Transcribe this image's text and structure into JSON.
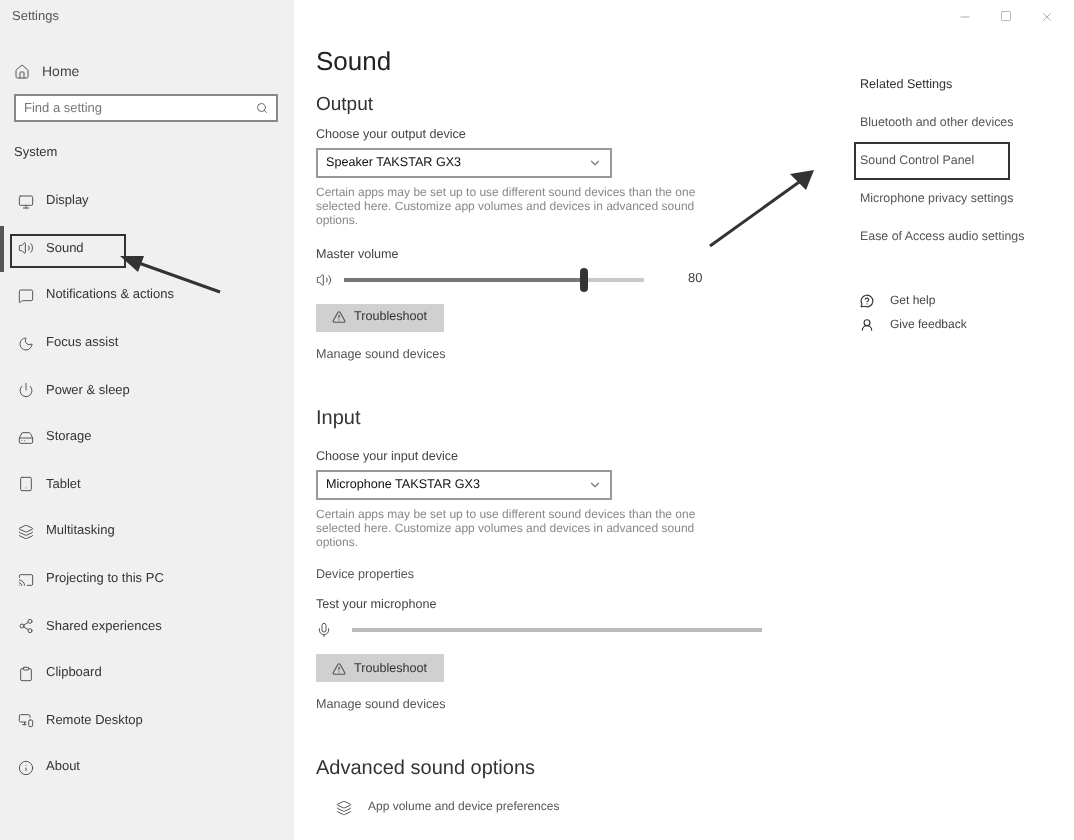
{
  "window": {
    "title": "Settings"
  },
  "sidebar": {
    "home": "Home",
    "search": {
      "placeholder": "Find a setting"
    },
    "section": "System",
    "items": [
      {
        "label": "Display",
        "selected": false,
        "annotated": false
      },
      {
        "label": "Sound",
        "selected": true,
        "annotated": true
      },
      {
        "label": "Notifications & actions",
        "selected": false,
        "annotated": false
      },
      {
        "label": "Focus assist",
        "selected": false,
        "annotated": false
      },
      {
        "label": "Power & sleep",
        "selected": false,
        "annotated": false
      },
      {
        "label": "Storage",
        "selected": false,
        "annotated": false
      },
      {
        "label": "Tablet",
        "selected": false,
        "annotated": false
      },
      {
        "label": "Multitasking",
        "selected": false,
        "annotated": false
      },
      {
        "label": "Projecting to this PC",
        "selected": false,
        "annotated": false
      },
      {
        "label": "Shared experiences",
        "selected": false,
        "annotated": false
      },
      {
        "label": "Clipboard",
        "selected": false,
        "annotated": false
      },
      {
        "label": "Remote Desktop",
        "selected": false,
        "annotated": false
      },
      {
        "label": "About",
        "selected": false,
        "annotated": false
      }
    ]
  },
  "page": {
    "title": "Sound",
    "output": {
      "heading": "Output",
      "device_label": "Choose your output device",
      "device": "Speaker TAKSTAR GX3",
      "note": "Certain apps may be set up to use different sound devices than the one selected here. Customize app volumes and devices in advanced sound options.",
      "volume_label": "Master volume",
      "volume": {
        "level": 0.8,
        "reading": "80"
      },
      "troubleshoot": "Troubleshoot",
      "manage": "Manage sound devices"
    },
    "input": {
      "heading": "Input",
      "device_label": "Choose your input device",
      "device": "Microphone TAKSTAR GX3",
      "note": "Certain apps may be set up to use different sound devices than the one selected here. Customize app volumes and devices in advanced sound options.",
      "properties": "Device properties",
      "test_label": "Test your microphone",
      "mic": {
        "level": 0
      },
      "troubleshoot": "Troubleshoot",
      "manage": "Manage sound devices"
    },
    "advanced": {
      "heading": "Advanced sound options",
      "item": "App volume and device preferences"
    }
  },
  "related": {
    "heading": "Related Settings",
    "links": [
      {
        "label": "Bluetooth and other devices",
        "annotated": false
      },
      {
        "label": "Sound Control Panel",
        "annotated": true
      },
      {
        "label": "Microphone privacy settings",
        "annotated": false
      },
      {
        "label": "Ease of Access audio settings",
        "annotated": false
      }
    ],
    "help": [
      {
        "label": "Get help",
        "kind": "help"
      },
      {
        "label": "Give feedback",
        "kind": "feedback"
      }
    ]
  }
}
